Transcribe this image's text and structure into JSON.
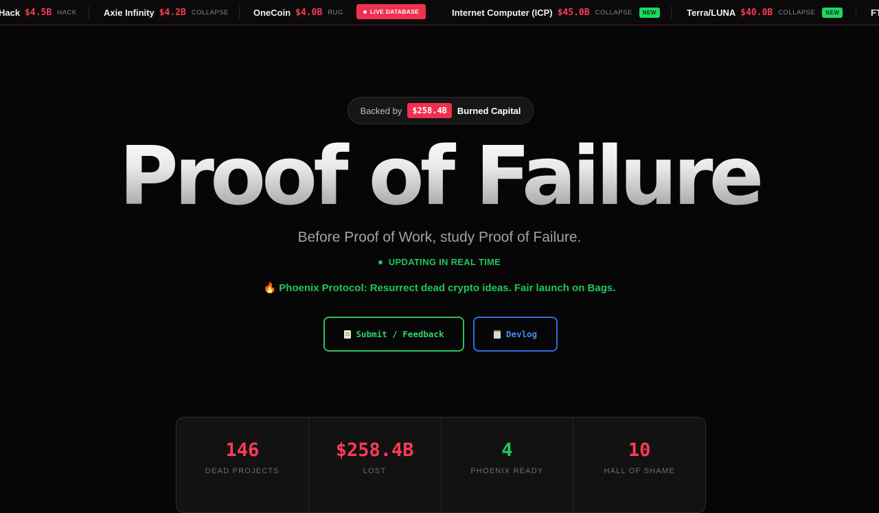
{
  "ticker": {
    "items": [
      {
        "name": "Hack",
        "amount": "$4.5B",
        "type": "HACK",
        "is_new": false
      },
      {
        "name": "Axie Infinity",
        "amount": "$4.2B",
        "type": "COLLAPSE",
        "is_new": false
      },
      {
        "name": "OneCoin",
        "amount": "$4.0B",
        "type": "RUG",
        "is_new": false
      },
      {
        "name": "Internet Computer (ICP)",
        "amount": "$45.0B",
        "type": "COLLAPSE",
        "is_new": true
      },
      {
        "name": "Terra/LUNA",
        "amount": "$40.0B",
        "type": "COLLAPSE",
        "is_new": true
      },
      {
        "name": "FT",
        "amount": "",
        "type": "",
        "is_new": false
      }
    ],
    "new_label": "NEW",
    "live_label": "LIVE DATABASE"
  },
  "backed": {
    "prefix": "Backed by",
    "amount": "$258.4B",
    "suffix": "Burned Capital"
  },
  "hero": {
    "title": "Proof of Failure",
    "subtitle": "Before Proof of Work, study Proof of Failure.",
    "realtime": "UPDATING IN REAL TIME",
    "phoenix": "Phoenix Protocol: Resurrect dead crypto ideas. Fair launch on Bags."
  },
  "buttons": {
    "submit": "Submit / Feedback",
    "devlog": "Devlog"
  },
  "stats": [
    {
      "value": "146",
      "label": "DEAD PROJECTS",
      "color": "#ff3b55"
    },
    {
      "value": "$258.4B",
      "label": "LOST",
      "color": "#ff3b55"
    },
    {
      "value": "4",
      "label": "PHOENIX READY",
      "color": "#22c55e"
    },
    {
      "value": "10",
      "label": "HALL OF SHAME",
      "color": "#ff3b55"
    }
  ],
  "colors": {
    "accent_red": "#f0304f",
    "accent_green": "#22c55e",
    "accent_blue": "#2f6fe0"
  }
}
